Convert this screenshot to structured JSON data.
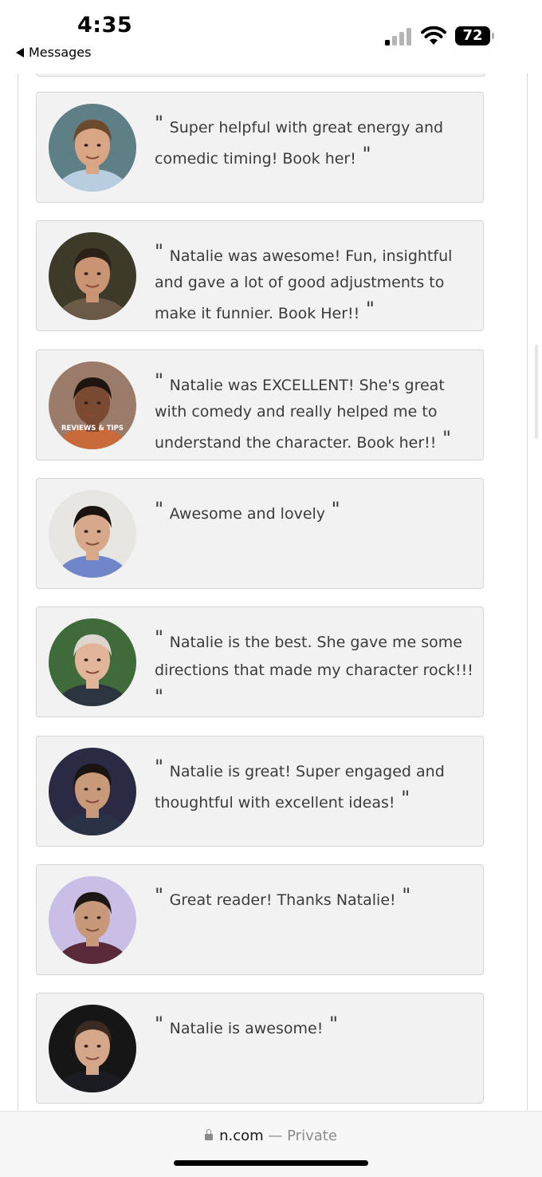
{
  "status_bar": {
    "time": "4:35",
    "back_label": "Messages",
    "battery": "72"
  },
  "reviews": [
    {
      "text": "Super helpful with great energy and comedic timing! Book her!",
      "avatar_bg": "#5e7f86",
      "skin": "#d9a685",
      "hair": "#6b4a2e",
      "shirt": "#b9cde0"
    },
    {
      "text": "Natalie was awesome! Fun, insightful and gave a lot of good adjustments to make it funnier. Book Her!!",
      "avatar_bg": "#3d3a2a",
      "skin": "#c89474",
      "hair": "#2b2118",
      "shirt": "#6b5a45"
    },
    {
      "text": "Natalie was EXCELLENT! She's great with comedy and really helped me to understand the character. Book her!!",
      "avatar_bg": "#9b7b6a",
      "skin": "#7a4a32",
      "hair": "#1e1410",
      "shirt": "#c86a3a",
      "overlay": "REVIEWS & TIPS"
    },
    {
      "text": "Awesome and lovely",
      "avatar_bg": "#e8e6e2",
      "skin": "#d7a88a",
      "hair": "#1a120e",
      "shirt": "#6f86c8"
    },
    {
      "text": "Natalie is the best. She gave me some directions that made my character rock!!!",
      "avatar_bg": "#3f6a3a",
      "skin": "#e2b49a",
      "hair": "#dcd6cf",
      "shirt": "#2c3440"
    },
    {
      "text": "Natalie is great! Super engaged and thoughtful with excellent ideas!",
      "avatar_bg": "#2a2a44",
      "skin": "#c99a7a",
      "hair": "#1a1412",
      "shirt": "#2a3246"
    },
    {
      "text": "Great reader! Thanks Natalie!",
      "avatar_bg": "#c9bfe6",
      "skin": "#c7987a",
      "hair": "#1d1714",
      "shirt": "#5a2a3a"
    },
    {
      "text": "Natalie is awesome!",
      "avatar_bg": "#161616",
      "skin": "#d4a68a",
      "hair": "#3a2a20",
      "shirt": "#1a1c22"
    }
  ],
  "browser": {
    "url": "n.com",
    "separator": "—",
    "mode": "Private"
  }
}
